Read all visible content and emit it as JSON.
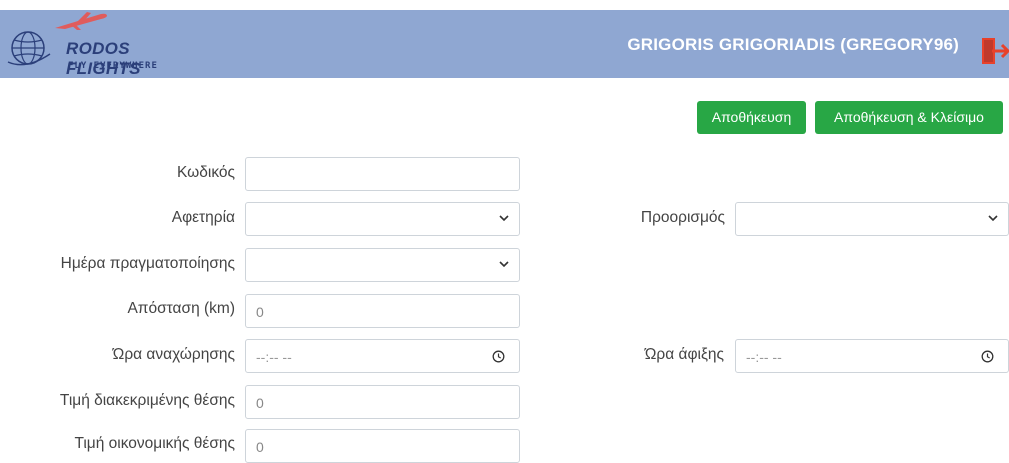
{
  "header": {
    "brand_name": "RODOS FLIGHTS",
    "brand_tagline": "FLY EVERYWHERE",
    "user_display": "GRIGORIS GRIGORIADIS (GREGORY96)",
    "colors": {
      "bar": "#8fa7d2",
      "brand_text": "#2b3f7a",
      "plane": "#e05c5c",
      "logout": "#e8412a"
    }
  },
  "actions": {
    "save_label": "Αποθήκευση",
    "save_close_label": "Αποθήκευση & Κλείσιμο",
    "button_color": "#28a745"
  },
  "form": {
    "code": {
      "label": "Κωδικός",
      "value": ""
    },
    "departure": {
      "label": "Αφετηρία",
      "value": ""
    },
    "destination": {
      "label": "Προορισμός",
      "value": ""
    },
    "day": {
      "label": "Ημέρα πραγματοποίησης",
      "value": ""
    },
    "distance": {
      "label": "Απόσταση (km)",
      "value": "0"
    },
    "departure_time": {
      "label": "Ώρα αναχώρησης",
      "placeholder": "--:-- --"
    },
    "arrival_time": {
      "label": "Ώρα άφιξης",
      "placeholder": "--:-- --"
    },
    "business_price": {
      "label": "Τιμή διακεκριμένης θέσης",
      "value": "0"
    },
    "economy_price": {
      "label": "Τιμή οικονομικής θέσης",
      "value": "0"
    }
  }
}
